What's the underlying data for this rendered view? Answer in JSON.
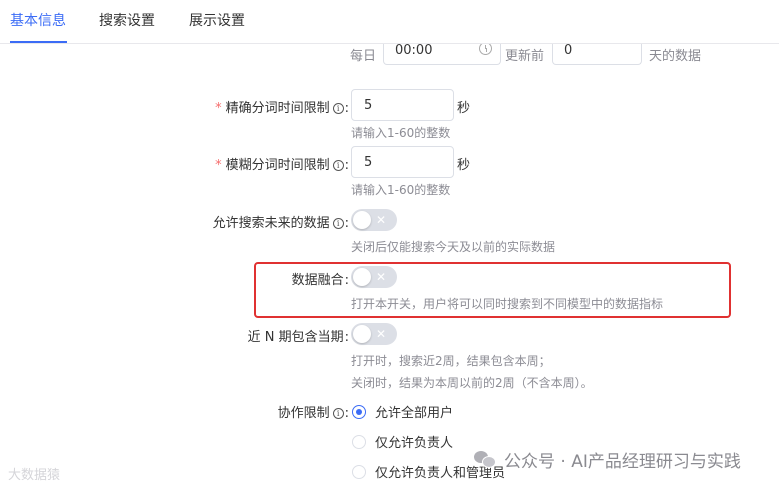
{
  "tabs": [
    {
      "label": "基本信息",
      "active": true
    },
    {
      "label": "搜索设置",
      "active": false
    },
    {
      "label": "展示设置",
      "active": false
    }
  ],
  "update_row": {
    "prefix": "每日",
    "time_value": "00:00",
    "middle": "更新前",
    "days_value": "0",
    "suffix": "天的数据"
  },
  "fields": {
    "exact_limit": {
      "label": "精确分词时间限制",
      "required": true,
      "value": "5",
      "unit": "秒",
      "hint": "请输入1-60的整数"
    },
    "fuzzy_limit": {
      "label": "模糊分词时间限制",
      "required": true,
      "value": "5",
      "unit": "秒",
      "hint": "请输入1-60的整数"
    },
    "allow_future": {
      "label": "允许搜索未来的数据",
      "on": false,
      "hint": "关闭后仅能搜索今天及以前的实际数据"
    },
    "data_fusion": {
      "label": "数据融合",
      "on": false,
      "hint": "打开本开关，用户将可以同时搜索到不同模型中的数据指标"
    },
    "include_current": {
      "label": "近 N 期包含当期",
      "on": false,
      "hint_line1": "打开时，搜索近2周，结果包含本周；",
      "hint_line2": "关闭时，结果为本周以前的2周（不含本周）。"
    },
    "collab_limit": {
      "label": "协作限制",
      "options": [
        {
          "label": "允许全部用户",
          "checked": true
        },
        {
          "label": "仅允许负责人",
          "checked": false
        },
        {
          "label": "仅允许负责人和管理员",
          "checked": false
        }
      ]
    }
  },
  "common": {
    "info_symbol": "i",
    "colon": ":",
    "required_mark": "*",
    "toggle_off_symbol": "✕"
  },
  "watermarks": {
    "left": "大数据猿",
    "right": "公众号 · AI产品经理研习与实践"
  },
  "colors": {
    "accent": "#3b6cf6",
    "highlight": "#e03131",
    "required": "#f56c6c"
  }
}
